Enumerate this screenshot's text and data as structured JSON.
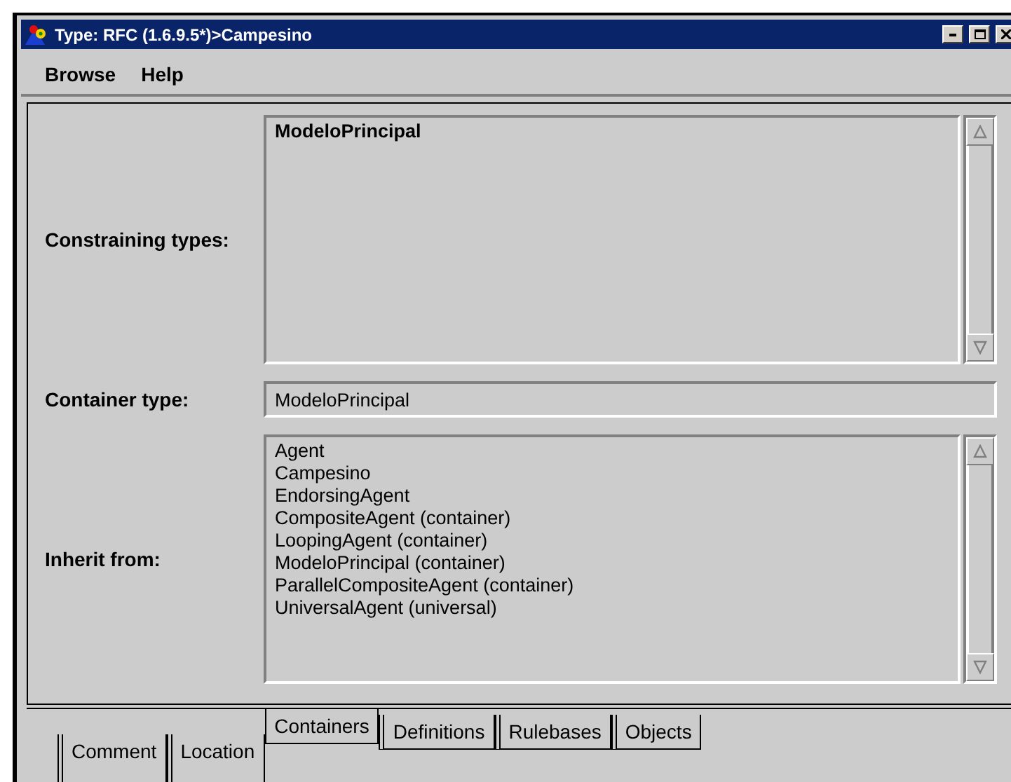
{
  "window": {
    "title": "Type: RFC (1.6.9.5*)>Campesino"
  },
  "menu": [
    "Browse",
    "Help"
  ],
  "constraining_types": {
    "label": "Constraining types:",
    "items": [
      {
        "text": "ModeloPrincipal",
        "selected": true
      }
    ]
  },
  "container_type": {
    "label": "Container type:",
    "value": "ModeloPrincipal"
  },
  "inherit_from": {
    "label": "Inherit from:",
    "items": [
      {
        "text": "Agent",
        "selected": false
      },
      {
        "text": "Campesino",
        "selected": false
      },
      {
        "text": "EndorsingAgent",
        "selected": false
      },
      {
        "text": "CompositeAgent (container)",
        "selected": false
      },
      {
        "text": "LoopingAgent (container)",
        "selected": false
      },
      {
        "text": "ModeloPrincipal (container)",
        "selected": false
      },
      {
        "text": "ParallelCompositeAgent (container)",
        "selected": false
      },
      {
        "text": "UniversalAgent (universal)",
        "selected": false
      }
    ]
  },
  "tabs": [
    {
      "label": "Comment",
      "kind": "back",
      "selected": false
    },
    {
      "label": "Location",
      "kind": "back",
      "selected": false
    },
    {
      "label": "Containers",
      "kind": "front",
      "selected": true
    },
    {
      "label": "Definitions",
      "kind": "front",
      "selected": false
    },
    {
      "label": "Rulebases",
      "kind": "front",
      "selected": false
    },
    {
      "label": "Objects",
      "kind": "front",
      "selected": false
    }
  ]
}
